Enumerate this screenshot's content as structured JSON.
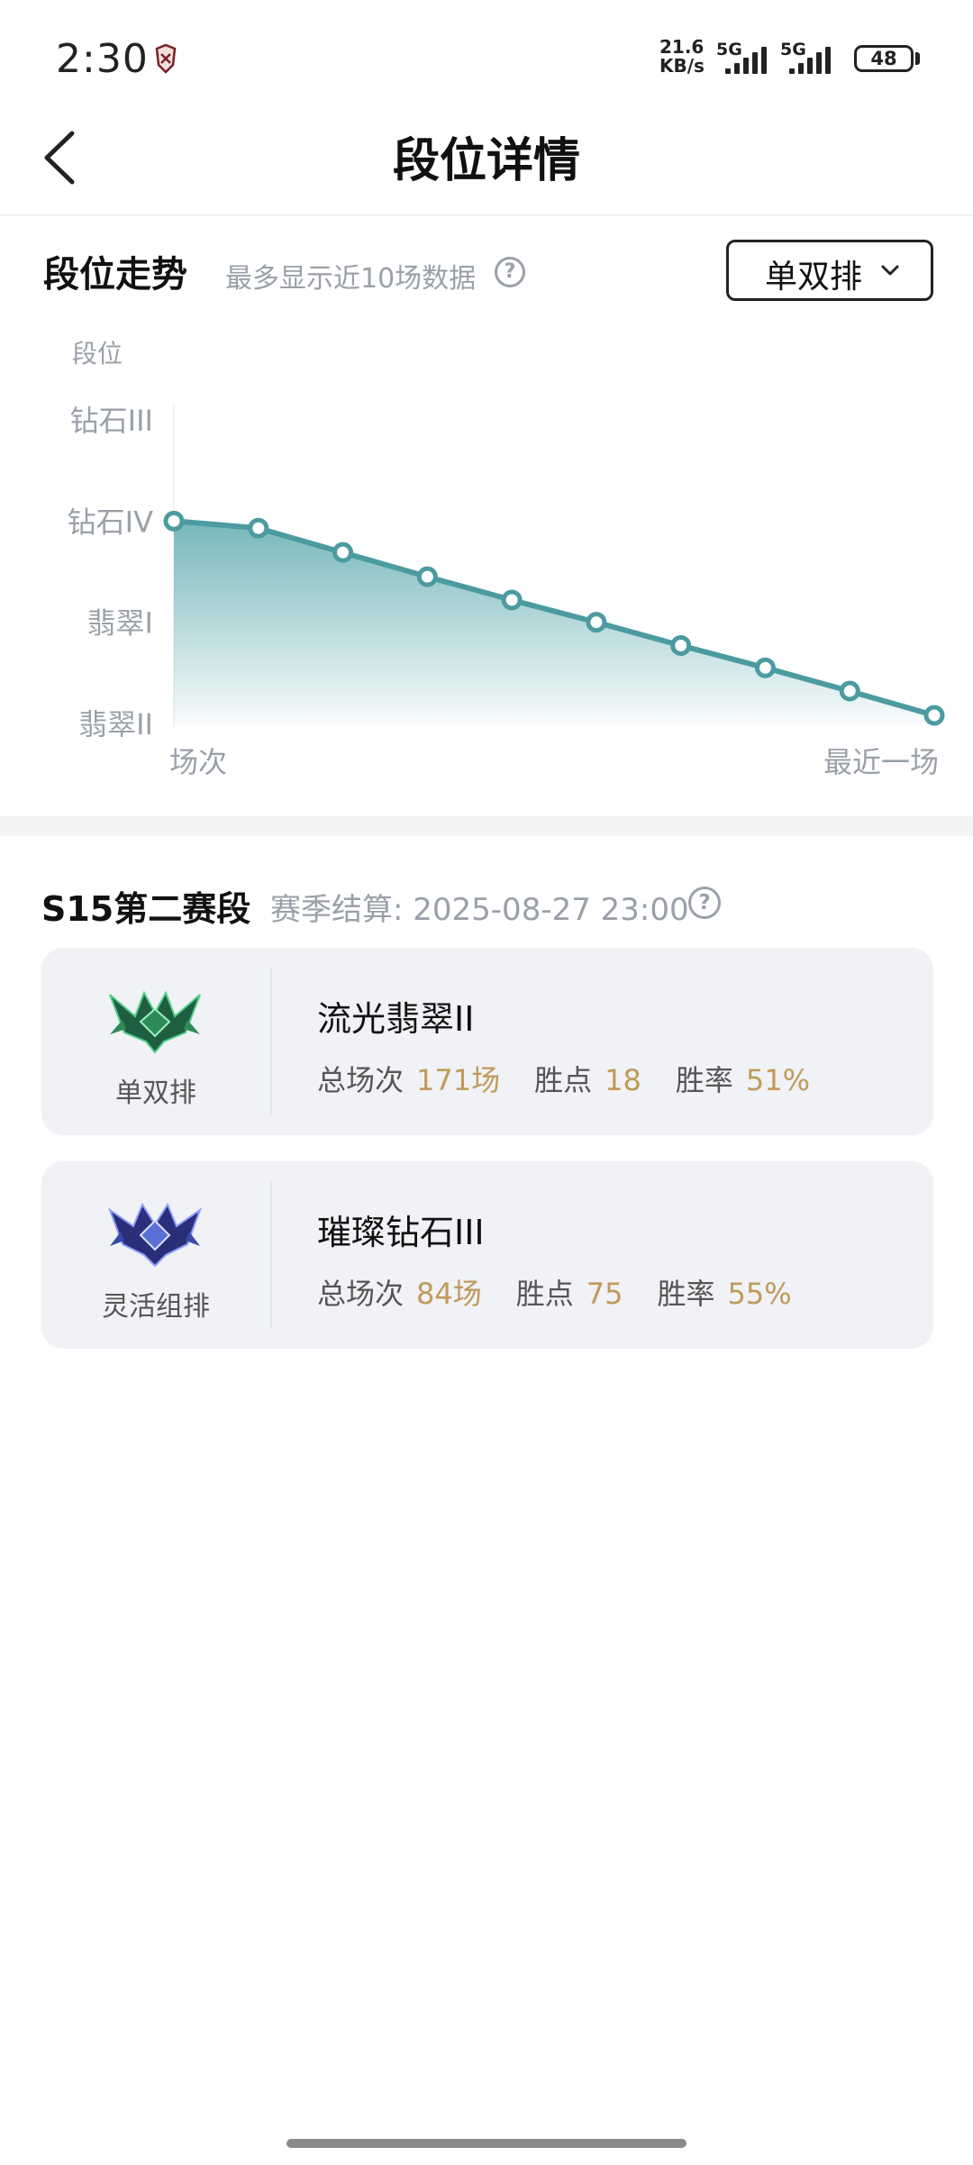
{
  "status_bar": {
    "time": "2:30",
    "net_speed_value": "21.6",
    "net_speed_unit": "KB/s",
    "signal_1_label": "5G",
    "signal_2_label": "5G",
    "battery_level": "48",
    "app_icon": "app-notification-icon"
  },
  "header": {
    "title": "段位详情",
    "back_icon": "back-arrow-icon"
  },
  "trend": {
    "title": "段位走势",
    "hint": "最多显示近10场数据",
    "help_icon": "question-circle-icon",
    "selector_label": "单双排",
    "selector_icon": "chevron-down-icon"
  },
  "chart_data": {
    "type": "area",
    "ylabel": "段位",
    "y_tick_labels": [
      "钻石III",
      "钻石IV",
      "翡翠I",
      "翡翠II"
    ],
    "ylim": [
      0,
      3
    ],
    "x_start_label": "场次",
    "x_end_label": "最近一场",
    "x": [
      1,
      2,
      3,
      4,
      5,
      6,
      7,
      8,
      9,
      10
    ],
    "series": [
      {
        "values": [
          2.0,
          1.93,
          1.69,
          1.45,
          1.22,
          1.0,
          0.77,
          0.55,
          0.32,
          0.08
        ]
      }
    ],
    "line_color": "#4b9ba0",
    "fill_color": "#6fb3b8",
    "grid": false
  },
  "season": {
    "title": "S15第二赛段",
    "settle_label": "赛季结算: 2025-08-27 23:00",
    "help_icon": "question-circle-icon",
    "cards": [
      {
        "queue": "单双排",
        "rank": "流光翡翠II",
        "emblem": "emerald-rank-emblem-icon",
        "emblem_color": "#2f8a5a",
        "games_label": "总场次",
        "games_value": "171场",
        "lp_label": "胜点",
        "lp_value": "18",
        "winrate_label": "胜率",
        "winrate_value": "51%"
      },
      {
        "queue": "灵活组排",
        "rank": "璀璨钻石III",
        "emblem": "diamond-rank-emblem-icon",
        "emblem_color": "#3b4aa8",
        "games_label": "总场次",
        "games_value": "84场",
        "lp_label": "胜点",
        "lp_value": "75",
        "winrate_label": "胜率",
        "winrate_value": "55%"
      }
    ]
  }
}
